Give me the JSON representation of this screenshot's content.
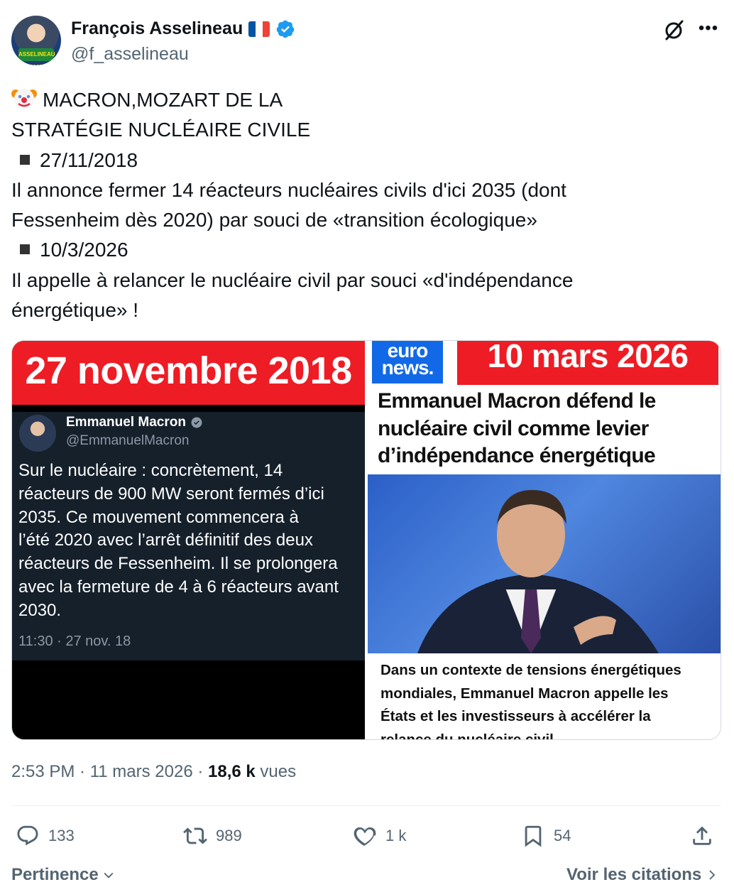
{
  "author": {
    "name": "François Asselineau",
    "handle": "@f_asselineau",
    "avatar_badge": "ASSELINEAU 2027"
  },
  "tweet": {
    "lines": [
      "MACRON,MOZART DE LA",
      "STRATÉGIE NUCLÉAIRE CIVILE",
      "27/11/2018",
      "Il annonce fermer 14 réacteurs nucléaires civils d'ici 2035 (dont",
      "Fessenheim dès 2020) par souci de «transition écologique»",
      "10/3/2026",
      "Il appelle à relancer le nucléaire civil par souci «d'indépendance",
      "énergétique» !"
    ]
  },
  "media": {
    "left": {
      "banner": "27 novembre 2018",
      "quoted_name": "Emmanuel Macron",
      "quoted_handle": "@EmmanuelMacron",
      "quoted_lines": [
        "Sur le nucléaire : concrètement, 14",
        "réacteurs de 900 MW seront fermés d’ici",
        "2035. Ce mouvement commencera à",
        "l’été 2020 avec l’arrêt définitif des deux",
        "réacteurs de Fessenheim. Il se prolongera",
        "avec la fermeture de 4 à 6 réacteurs avant",
        "2030."
      ],
      "quoted_time": "11:30 · 27 nov. 18"
    },
    "right": {
      "logo_line1": "euro",
      "logo_line2": "news.",
      "banner": "10 mars 2026",
      "headline_lines": [
        "Emmanuel Macron défend le",
        "nucléaire civil comme levier",
        "d’indépendance énergétique"
      ],
      "desc_lines": [
        "Dans un contexte de tensions énergétiques",
        "mondiales, Emmanuel Macron appelle les",
        "États et les investisseurs à accélérer la",
        "relance du nucléaire civil"
      ]
    }
  },
  "meta": {
    "time": "2:53 PM",
    "sep1": " · ",
    "date": "11 mars 2026",
    "sep2": " · ",
    "views_count": "18,6 k",
    "views_label": " vues"
  },
  "actions": {
    "replies": "133",
    "reposts": "989",
    "likes": "1 k",
    "bookmarks": "54"
  },
  "footer": {
    "sort_label": "Pertinence",
    "quotes_label": "Voir les citations"
  },
  "colors": {
    "verified": "#1d9bf0",
    "banner_red": "#ee1c24",
    "euronews_blue": "#1269e7",
    "muted_text": "#536471"
  }
}
